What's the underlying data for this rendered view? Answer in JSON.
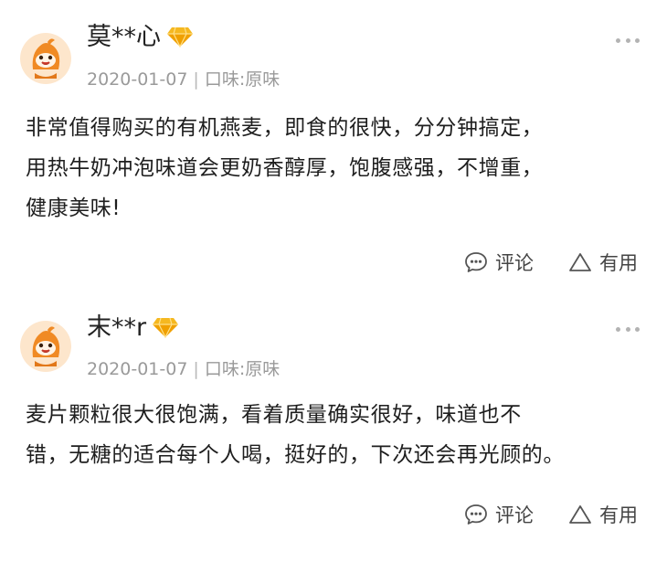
{
  "reviews": [
    {
      "username": "莫**心",
      "date": "2020-01-07",
      "separator": "|",
      "flavor": "口味:原味",
      "content_lines": [
        "非常值得购买的有机燕麦，即食的很快，分分钟搞定，",
        "用热牛奶冲泡味道会更奶香醇厚，饱腹感强，不增重，",
        "健康美味!"
      ],
      "comment_label": "评论",
      "useful_label": "有用"
    },
    {
      "username": "末**r",
      "date": "2020-01-07",
      "separator": "|",
      "flavor": "口味:原味",
      "content_lines": [
        "麦片颗粒很大很饱满，看着质量确实很好，味道也不",
        "错，无糖的适合每个人喝，挺好的，下次还会再光顾的。"
      ],
      "comment_label": "评论",
      "useful_label": "有用"
    }
  ],
  "colors": {
    "avatar_orange": "#f08a24",
    "vip_gold": "#f5b820",
    "meta_gray": "#9a9a9a",
    "text": "#1e1e1e"
  },
  "icons": {
    "avatar": "orange-mascot-avatar",
    "vip": "diamond-icon",
    "more": "more-dots-icon",
    "comment": "chat-bubble-icon",
    "useful": "triangle-up-icon"
  }
}
